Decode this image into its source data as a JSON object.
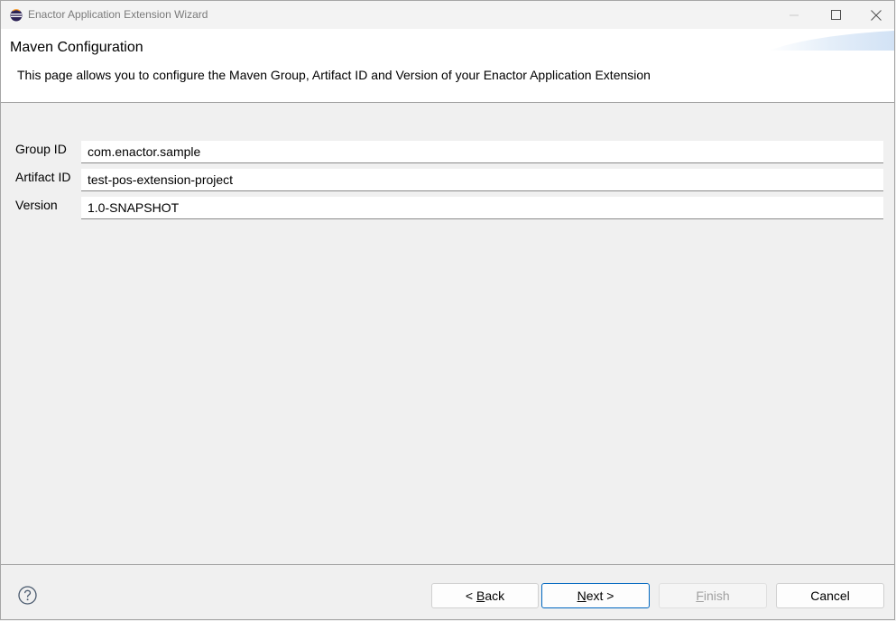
{
  "window": {
    "title": "Enactor Application Extension Wizard",
    "icon": "eclipse-icon",
    "controls": [
      "minimize-icon",
      "maximize-icon",
      "close-icon"
    ]
  },
  "header": {
    "title": "Maven Configuration",
    "description": "This page allows you to configure the Maven Group, Artifact ID and Version of your Enactor Application Extension"
  },
  "form": {
    "group_id": {
      "label": "Group ID",
      "value": "com.enactor.sample"
    },
    "artifact_id": {
      "label": "Artifact ID",
      "value": "test-pos-extension-project"
    },
    "version": {
      "label": "Version",
      "value": "1.0-SNAPSHOT"
    }
  },
  "buttons": {
    "help_icon": "help-icon",
    "back": {
      "prefix": "< ",
      "mnemonic": "B",
      "rest": "ack"
    },
    "next": {
      "mnemonic": "N",
      "rest": "ext >"
    },
    "finish": {
      "mnemonic": "F",
      "rest": "inish",
      "enabled": false
    },
    "cancel": {
      "label": "Cancel"
    }
  },
  "colors": {
    "accent": "#0067c0",
    "banner": "#dbe8f7"
  }
}
